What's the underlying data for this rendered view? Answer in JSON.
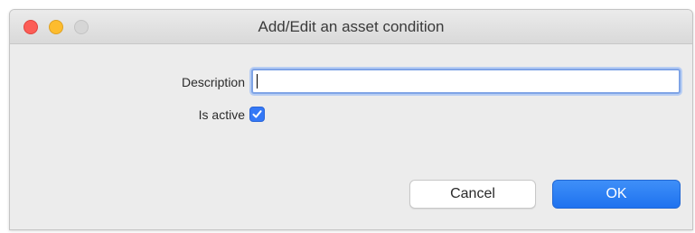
{
  "window": {
    "title": "Add/Edit an asset condition",
    "controls": {
      "close_color": "#fc5d56",
      "minimize_color": "#fdbc2e",
      "zoom_color": "#d6d6d6"
    }
  },
  "form": {
    "description_label": "Description",
    "description_value": "",
    "is_active_label": "Is active",
    "is_active_checked": true
  },
  "buttons": {
    "cancel_label": "Cancel",
    "ok_label": "OK"
  },
  "colors": {
    "accent": "#3478f6",
    "window_bg": "#ececec"
  }
}
